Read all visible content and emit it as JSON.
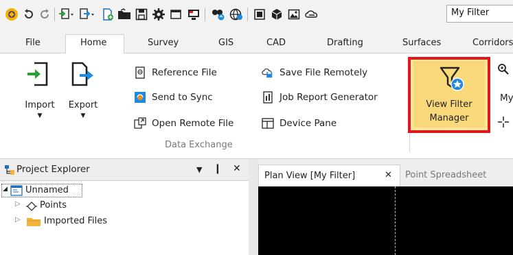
{
  "qat": {
    "filter_value": "My Filter"
  },
  "tabs": [
    "File",
    "Home",
    "Survey",
    "GIS",
    "CAD",
    "Drafting",
    "Surfaces",
    "Corridors"
  ],
  "ribbon": {
    "import_label": "Import",
    "export_label": "Export",
    "data_exchange_items": [
      "Reference File",
      "Send to Sync",
      "Open Remote File",
      "Save File Remotely",
      "Job Report Generator",
      "Device Pane"
    ],
    "group_label": "Data Exchange",
    "view_filter_manager_label_line1": "View Filter",
    "view_filter_manager_label_line2": "Manager",
    "partial_right_label": "My"
  },
  "project_explorer": {
    "title": "Project Explorer",
    "pin_glyph": "❙",
    "close_glyph": "✕",
    "tree": {
      "root_label": "Unnamed",
      "children": [
        "Points",
        "Imported Files"
      ]
    }
  },
  "doc_tabs": {
    "active_label": "Plan View [My Filter]",
    "close_glyph": "✕",
    "inactive_label": "Point Spreadsheet"
  },
  "colors": {
    "highlight_border": "#e3171b",
    "button_highlight": "#f9d97a",
    "accent_blue": "#1e8be0",
    "accent_green": "#2e9e3a"
  }
}
